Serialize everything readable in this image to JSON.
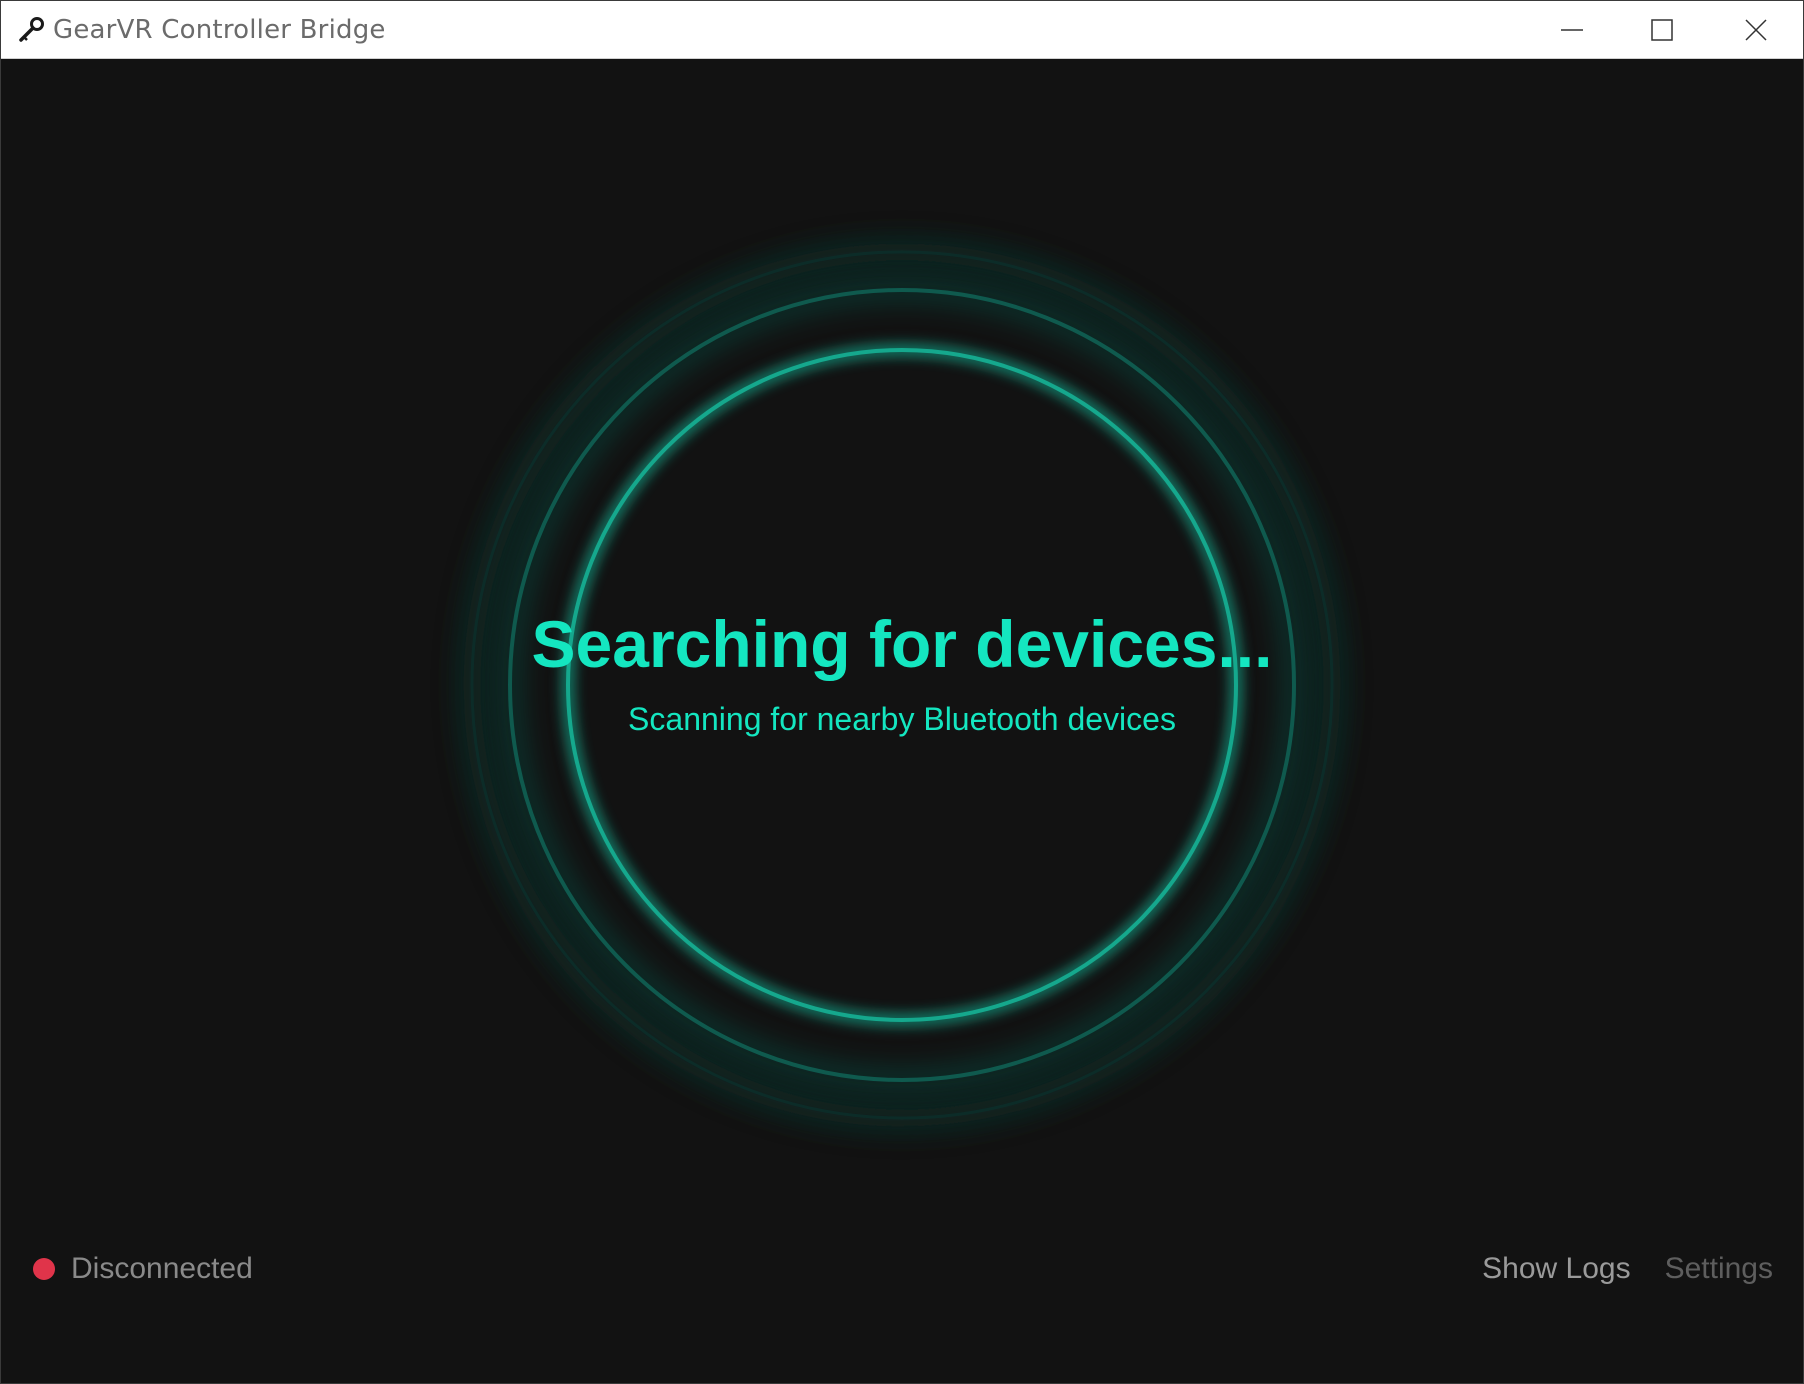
{
  "window": {
    "title": "GearVR Controller Bridge",
    "icon": "key-icon",
    "controls": {
      "minimize_icon": "minimize-icon",
      "maximize_icon": "maximize-icon",
      "close_icon": "close-icon"
    }
  },
  "scan": {
    "heading": "Searching for devices...",
    "subheading": "Scanning for nearby Bluetooth devices",
    "accent_color": "#14e6c0"
  },
  "status": {
    "text": "Disconnected",
    "dot_color": "#e0344a"
  },
  "footer": {
    "show_logs_label": "Show Logs",
    "settings_label": "Settings"
  }
}
